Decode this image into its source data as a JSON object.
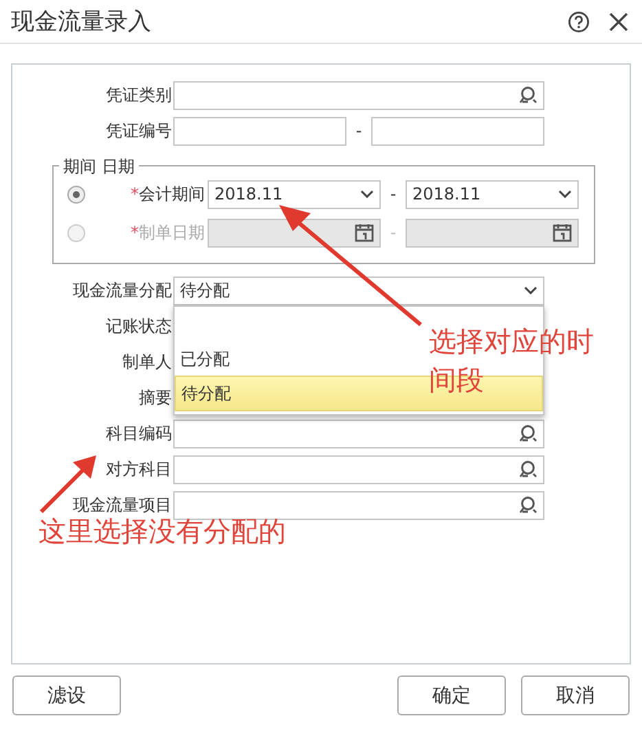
{
  "window": {
    "title": "现金流量录入"
  },
  "voucher_type": {
    "label": "凭证类别"
  },
  "voucher_number": {
    "label": "凭证编号",
    "separator": "-"
  },
  "period_group": {
    "legend": "期间 日期",
    "rows": [
      {
        "kind": "select",
        "required_mark": "*",
        "label": "会计期间",
        "selected": true,
        "disabled": false,
        "from": "2018.11",
        "to": "2018.11",
        "separator": "-"
      },
      {
        "kind": "date",
        "required_mark": "*",
        "label": "制单日期",
        "selected": false,
        "disabled": true,
        "separator": "-"
      }
    ]
  },
  "cash_flow_allocation": {
    "label": "现金流量分配",
    "value": "待分配",
    "options": [
      {
        "label": "已分配",
        "selected": false
      },
      {
        "label": "待分配",
        "selected": true
      }
    ]
  },
  "covered_fields": [
    {
      "label": "记账状态"
    },
    {
      "label": "制单人"
    },
    {
      "label": "摘要"
    }
  ],
  "lookup_fields": [
    {
      "label": "科目编码"
    },
    {
      "label": "对方科目"
    },
    {
      "label": "现金流量项目"
    }
  ],
  "buttons": [
    {
      "label": "滤设"
    },
    {
      "label": "确定"
    },
    {
      "label": "取消"
    }
  ],
  "annotations": [
    {
      "text": "选择对应的时间段"
    },
    {
      "text": "这里选择没有分配的"
    }
  ]
}
